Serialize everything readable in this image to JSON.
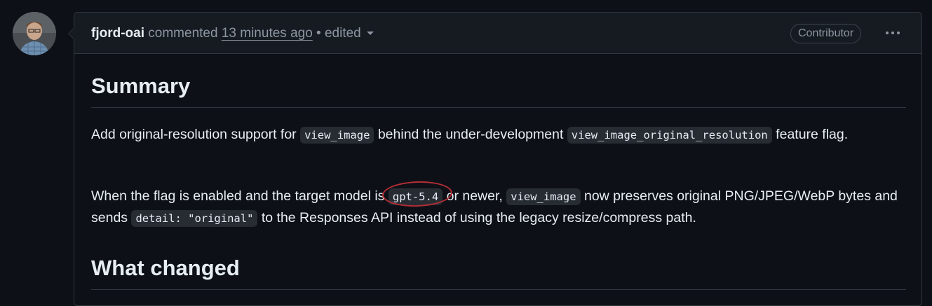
{
  "comment": {
    "author": "fjord-oai",
    "action": "commented",
    "timestamp": "13 minutes ago",
    "separator": "•",
    "edited": "edited",
    "badge": "Contributor"
  },
  "body": {
    "heading_summary": "Summary",
    "p1": {
      "t1": "Add original-resolution support for ",
      "c1": "view_image",
      "t2": " behind the under-development ",
      "c2": "view_image_original_resolution",
      "t3": " feature flag."
    },
    "p2": {
      "t1": "When the flag is enabled and the target model is ",
      "c1": "gpt-5.4",
      "t2": " or newer, ",
      "c2": "view_image",
      "t3": " now preserves original PNG/JPEG/WebP bytes and sends ",
      "c3": "detail: \"original\"",
      "t4": " to the Responses API instead of using the legacy resize/compress path."
    },
    "heading_changed": "What changed"
  },
  "colors": {
    "background": "#0d1117",
    "header_bg": "#161b22",
    "border": "#30363d",
    "text": "#e6edf3",
    "muted": "#8d96a0",
    "code_bg": "#272c33",
    "annotation_circle": "#b42d35"
  }
}
